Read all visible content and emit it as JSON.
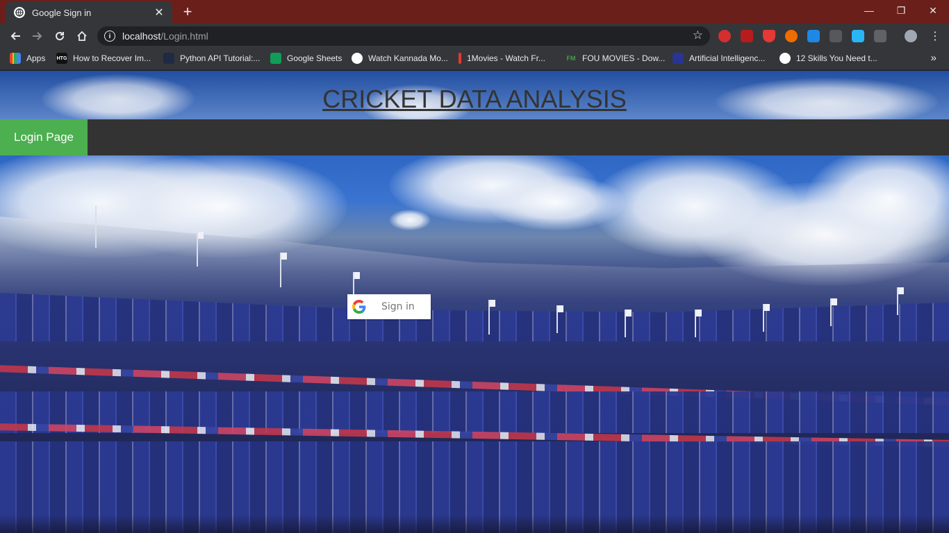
{
  "browser": {
    "tab": {
      "title": "Google Sign in",
      "close_glyph": "✕"
    },
    "new_tab_glyph": "+",
    "window_controls": {
      "minimize": "—",
      "restore": "❐",
      "close": "✕"
    },
    "address": {
      "host": "localhost",
      "path": "/Login.html"
    },
    "bookmarks": [
      {
        "label": "Apps",
        "icon": "apps-grid-icon",
        "color": "#ea4335"
      },
      {
        "label": "How to Recover Im...",
        "icon": "htg-icon",
        "badge": "HTG",
        "color": "#111111"
      },
      {
        "label": "Python API Tutorial:...",
        "icon": "python-icon",
        "color": "#1f2a44"
      },
      {
        "label": "Google Sheets",
        "icon": "sheets-icon",
        "color": "#0f9d58"
      },
      {
        "label": "Watch Kannada Mo...",
        "icon": "globe-icon",
        "color": "#ffffff"
      },
      {
        "label": "1Movies - Watch Fr...",
        "icon": "1movies-icon",
        "color": "#e53935"
      },
      {
        "label": "FOU MOVIES - Dow...",
        "icon": "fm-icon",
        "badge": "FM",
        "color": "#2e7d32"
      },
      {
        "label": "Artificial Intelligenc...",
        "icon": "ai-icon",
        "color": "#3949ab"
      },
      {
        "label": "12 Skills You Need t...",
        "icon": "globe-icon",
        "color": "#ffffff"
      }
    ],
    "bookmarks_more": "»"
  },
  "page": {
    "heading": "CRICKET DATA ANALYSIS",
    "nav": {
      "active_label": "Login Page"
    },
    "signin": {
      "label": "Sign in"
    }
  }
}
